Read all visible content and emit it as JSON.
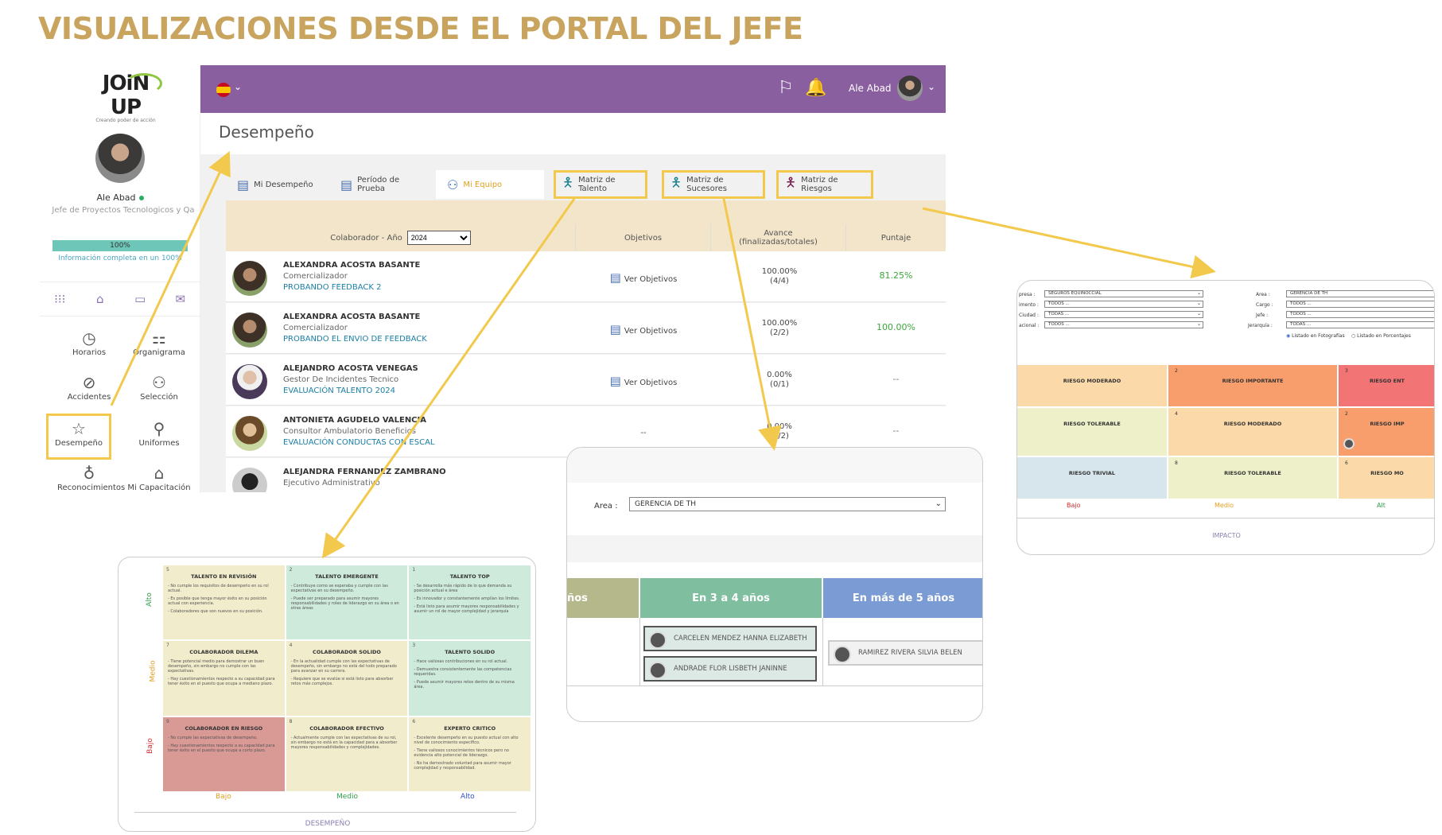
{
  "headline": "VISUALIZACIONES DESDE EL PORTAL DEL JEFE",
  "sidebar": {
    "logo_text": "JOiN UP",
    "logo_sub": "Creando poder de acción",
    "user_name": "Ale Abad",
    "user_role": "Jefe de Proyectos Tecnologicos y Qa",
    "progress": 100,
    "progress_label": "100%",
    "progress_note": "Información completa en un 100%",
    "quick_icons": [
      "apps-icon",
      "home-icon",
      "folder-icon",
      "mail-icon"
    ],
    "menu": [
      {
        "label": "Horarios",
        "icon": "clock-icon"
      },
      {
        "label": "Organigrama",
        "icon": "org-chart-icon"
      },
      {
        "label": "Accidentes",
        "icon": "bandage-icon"
      },
      {
        "label": "Selección",
        "icon": "people-icon"
      },
      {
        "label": "Desempeño",
        "icon": "star-icon"
      },
      {
        "label": "Uniformes",
        "icon": "uniform-icon"
      },
      {
        "label": "Reconocimientos",
        "icon": "medal-icon"
      },
      {
        "label": "Mi Capacitación",
        "icon": "graduation-icon"
      }
    ]
  },
  "topbar": {
    "user": "Ale Abad",
    "color": "#8a5fa0"
  },
  "page_title": "Desempeño",
  "tabs": [
    {
      "label": "Mi Desempeño"
    },
    {
      "label": "Período de Prueba"
    },
    {
      "label": "Mi Equipo"
    },
    {
      "label": "Matriz de Talento"
    },
    {
      "label": "Matriz de Sucesores"
    },
    {
      "label": "Matriz de Riesgos"
    }
  ],
  "table": {
    "col_colaborador": "Colaborador - Año",
    "year": "2024",
    "col_objetivos": "Objetivos",
    "col_avance": "Avance (finalizadas/totales)",
    "col_puntaje": "Puntaje",
    "rows": [
      {
        "name": "ALEXANDRA ACOSTA BASANTE",
        "cargo": "Comercializador",
        "eval": "PROBANDO FEEDBACK 2",
        "objetivos": "Ver Objetivos",
        "avance": "100.00%",
        "avance_frac": "(4/4)",
        "puntaje": "81.25%"
      },
      {
        "name": "ALEXANDRA ACOSTA BASANTE",
        "cargo": "Comercializador",
        "eval": "PROBANDO EL ENVIO DE FEEDBACK",
        "objetivos": "Ver Objetivos",
        "avance": "100.00%",
        "avance_frac": "(2/2)",
        "puntaje": "100.00%"
      },
      {
        "name": "ALEJANDRO ACOSTA VENEGAS",
        "cargo": "Gestor De Incidentes Tecnico",
        "eval": "EVALUACIÓN TALENTO 2024",
        "objetivos": "Ver Objetivos",
        "avance": "0.00%",
        "avance_frac": "(0/1)",
        "puntaje": "--"
      },
      {
        "name": "ANTONIETA AGUDELO VALENCIA",
        "cargo": "Consultor Ambulatorio Beneficios",
        "eval": "EVALUACIÓN CONDUCTAS CON ESCAL",
        "objetivos": "--",
        "avance": "0.00%",
        "avance_frac": "(0/2)",
        "puntaje": "--"
      },
      {
        "name": "ALEJANDRA FERNANDEZ ZAMBRANO",
        "cargo": "Ejecutivo Administrativo",
        "eval": "",
        "objetivos": "",
        "avance": "",
        "avance_frac": "",
        "puntaje": ""
      }
    ]
  },
  "talent_matrix": {
    "y_labels": [
      "Alto",
      "Medio",
      "Bajo"
    ],
    "x_labels": [
      "Bajo",
      "Medio",
      "Alto"
    ],
    "x_title": "DESEMPEÑO",
    "cells": [
      {
        "n": "5",
        "title": "TALENTO EN REVISIÓN",
        "color": "#f1eccb",
        "lines": [
          "- No cumple los requisitos de desempeño en su rol actual.",
          "- Es posible que tenga mayor éxito en su posición actual con experiencia.",
          "- Colaboradores que son nuevos en su posición."
        ]
      },
      {
        "n": "2",
        "title": "TALENTO EMERGENTE",
        "color": "#cdeadb",
        "lines": [
          "- Contribuye como se esperaba y cumple con las expectativas en su desempeño.",
          "- Puede ser preparado para asumir mayores responsabilidades y roles de liderazgo en su área o en otras áreas"
        ]
      },
      {
        "n": "1",
        "title": "TALENTO TOP",
        "color": "#cdeadb",
        "lines": [
          "- Se desarrolla más rápido de lo que demanda su posición actual e área",
          "- Es innovador y constantemente amplían los límites.",
          "- Está listo para asumir mayores responsabilidades y asumir un rol de mayor complejidad y jerarquía"
        ]
      },
      {
        "n": "7",
        "title": "COLABORADOR DILEMA",
        "color": "#f1eccb",
        "lines": [
          "- Tiene potencial medio para demostrar un buen desempeño, sin embargo no cumple con las expectativas.",
          "- Hay cuestionamientos respecto a su capacidad para tener éxito en el puesto que ocupa a mediano plazo."
        ]
      },
      {
        "n": "4",
        "title": "COLABORADOR SOLIDO",
        "color": "#f1eccb",
        "lines": [
          "- En la actualidad cumple con las expectativas de desempeño, sin embargo no está del todo preparado para avanzar en su carrera.",
          "- Requiere que se evalúe si está listo para absorber retos más complejos."
        ]
      },
      {
        "n": "3",
        "title": "TALENTO SOLIDO",
        "color": "#cdeadb",
        "lines": [
          "- Hace valiosas contribuciones en su rol actual.",
          "- Demuestra consistentemente las competencias requeridas.",
          "- Puede asumir mayores retos dentro de su misma área."
        ]
      },
      {
        "n": "9",
        "title": "COLABORADOR EN RIESGO",
        "color": "#d99a96",
        "lines": [
          "- No cumple las expectativas de desempeño.",
          "- Hay cuestionamientos respecto a su capacidad para tener éxito en el puesto que ocupa a corto plazo."
        ]
      },
      {
        "n": "8",
        "title": "COLABORADOR EFECTIVO",
        "color": "#f1eccb",
        "lines": [
          "- Actualmente cumple con las expectativas de su rol, sin embargo no está en la capacidad para a absorber mayores responsabilidades y complejidades."
        ]
      },
      {
        "n": "6",
        "title": "EXPERTO CRITICO",
        "color": "#f1eccb",
        "lines": [
          "- Excelente desempeño en su puesto actual con alto nivel de conocimiento específico.",
          "- Tiene valiosos conocimientos técnicos pero no evidencia alto potencial de liderazgo.",
          "- No ha demostrado voluntad para asumir mayor complejidad y responsabilidad."
        ]
      }
    ]
  },
  "succession": {
    "area_label": "Area :",
    "area_value": "GERENCIA DE TH",
    "headers": [
      {
        "label": "ños",
        "color": "#b5b88a"
      },
      {
        "label": "En 3 a 4 años",
        "color": "#7fbf9f"
      },
      {
        "label": "En más de 5 años",
        "color": "#7b9bd4"
      }
    ],
    "chips_col2": [
      "CARCELEN MENDEZ HANNA ELIZABETH",
      "ANDRADE FLOR LISBETH JANINNE"
    ],
    "chips_col3": [
      "RAMIREZ RIVERA SILVIA BELEN"
    ]
  },
  "risk_matrix": {
    "filters_left": [
      {
        "label": "presa :",
        "value": "SEGUROS EQUINOCCIAL"
      },
      {
        "label": "imento :",
        "value": "TODOS ..."
      },
      {
        "label": "Ciudad :",
        "value": "TODAS ..."
      },
      {
        "label": "acional :",
        "value": "TODOS ..."
      }
    ],
    "filters_right": [
      {
        "label": "Area :",
        "value": "GERENCIA DE TH"
      },
      {
        "label": "Cargo :",
        "value": "TODOS ..."
      },
      {
        "label": "Jefe :",
        "value": "TODOS ..."
      },
      {
        "label": "Jerarquía :",
        "value": "TODAS ..."
      }
    ],
    "radio_photos": "Listado en Fotografías",
    "radio_percent": "Listado en Porcentajes",
    "cells": [
      {
        "n": "",
        "title": "RIESGO MODERADO",
        "color": "#fbd9a8"
      },
      {
        "n": "2",
        "title": "RIESGO IMPORTANTE",
        "color": "#f89e6c"
      },
      {
        "n": "3",
        "title": "RIESGO ENT",
        "color": "#f27474"
      },
      {
        "n": "",
        "title": "RIESGO TOLERABLE",
        "color": "#edf0c9"
      },
      {
        "n": "4",
        "title": "RIESGO MODERADO",
        "color": "#fbd9a8"
      },
      {
        "n": "2",
        "title": "RIESGO IMP",
        "color": "#f89e6c"
      },
      {
        "n": "",
        "title": "RIESGO TRIVIAL",
        "color": "#d6e6ec"
      },
      {
        "n": "8",
        "title": "RIESGO TOLERABLE",
        "color": "#edf0c9"
      },
      {
        "n": "6",
        "title": "RIESGO MO",
        "color": "#fbd9a8"
      }
    ],
    "x_labels": [
      "Bajo",
      "Medio",
      "Alt"
    ],
    "x_title": "IMPACTO"
  }
}
